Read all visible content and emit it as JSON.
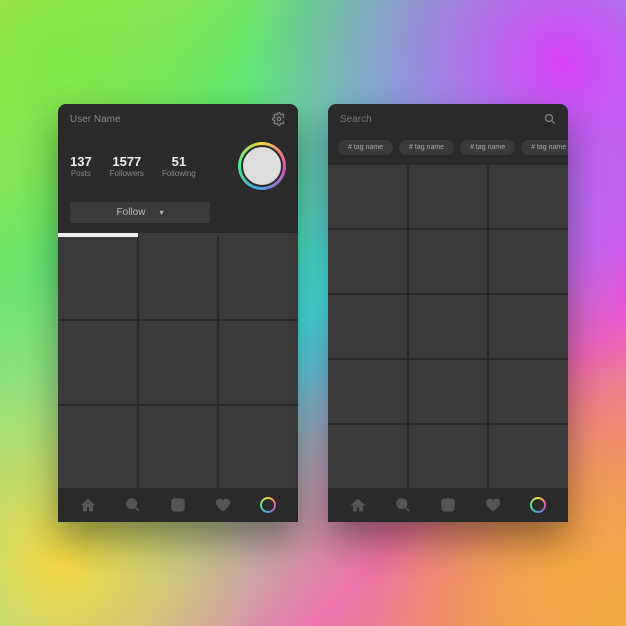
{
  "profile": {
    "header": {
      "title": "User Name"
    },
    "stats": {
      "posts": {
        "count": "137",
        "label": "Posts"
      },
      "followers": {
        "count": "1577",
        "label": "Followers"
      },
      "following": {
        "count": "51",
        "label": "Following"
      }
    },
    "follow_button": "Follow"
  },
  "search": {
    "placeholder": "Search",
    "tags": [
      "# tag name",
      "# tag name",
      "# tag name",
      "# tag name"
    ]
  },
  "colors": {
    "bg_dark": "#2a2a2a",
    "cell": "#3a3a3a",
    "text_muted": "#888"
  }
}
